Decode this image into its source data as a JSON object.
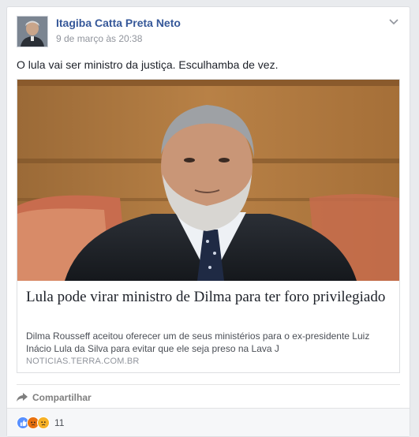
{
  "post": {
    "author": "Itagiba Catta Preta Neto",
    "timestamp": "9 de março às 20:38",
    "status_text": "O lula vai ser ministro da justiça. Esculhamba de vez."
  },
  "link_preview": {
    "title": "Lula pode virar ministro de Dilma para ter foro privilegiado",
    "description": "Dilma Rousseff aceitou oferecer um de seus ministérios para o ex-presidente Luiz Inácio Lula da Silva para evitar que ele seja preso na Lava J",
    "domain": "NOTICIAS.TERRA.COM.BR"
  },
  "actions": {
    "share_label": "Compartilhar"
  },
  "reactions": {
    "types": [
      "like-icon",
      "angry-icon",
      "sad-icon"
    ],
    "count": "11"
  },
  "colors": {
    "author_link": "#365899",
    "meta_gray": "#90949c",
    "like_blue": "#5890ff",
    "angry_orange": "#e9710f",
    "sad_yellow": "#f7b125"
  }
}
